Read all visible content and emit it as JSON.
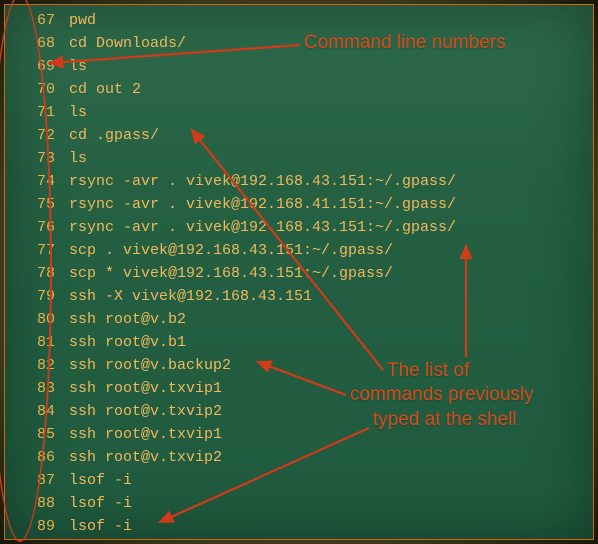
{
  "colors": {
    "text": "#f0b85a",
    "lineno": "#e6b24a",
    "annotation": "#d84a1a",
    "arrow": "#d23a1a",
    "terminal_bg": "#256043",
    "page_bg": "#5a5528"
  },
  "annotations": {
    "line_numbers": "Command line numbers",
    "list_line1": "The list of",
    "list_line2": "commands previously",
    "list_line3": "typed at the shell"
  },
  "history": [
    {
      "n": "67",
      "cmd": "pwd"
    },
    {
      "n": "68",
      "cmd": "cd Downloads/"
    },
    {
      "n": "69",
      "cmd": "ls"
    },
    {
      "n": "70",
      "cmd": "cd out 2"
    },
    {
      "n": "71",
      "cmd": "ls"
    },
    {
      "n": "72",
      "cmd": "cd .gpass/"
    },
    {
      "n": "73",
      "cmd": "ls"
    },
    {
      "n": "74",
      "cmd": "rsync -avr . vivek@192.168.43.151:~/.gpass/"
    },
    {
      "n": "75",
      "cmd": "rsync -avr . vivek@192.168.41.151:~/.gpass/"
    },
    {
      "n": "76",
      "cmd": "rsync -avr . vivek@192.168.43.151:~/.gpass/"
    },
    {
      "n": "77",
      "cmd": "scp . vivek@192.168.43.151:~/.gpass/"
    },
    {
      "n": "78",
      "cmd": "scp * vivek@192.168.43.151:~/.gpass/"
    },
    {
      "n": "79",
      "cmd": "ssh -X vivek@192.168.43.151"
    },
    {
      "n": "80",
      "cmd": "ssh root@v.b2"
    },
    {
      "n": "81",
      "cmd": "ssh root@v.b1"
    },
    {
      "n": "82",
      "cmd": "ssh root@v.backup2"
    },
    {
      "n": "83",
      "cmd": "ssh root@v.txvip1"
    },
    {
      "n": "84",
      "cmd": "ssh root@v.txvip2"
    },
    {
      "n": "85",
      "cmd": "ssh root@v.txvip1"
    },
    {
      "n": "86",
      "cmd": "ssh root@v.txvip2"
    },
    {
      "n": "87",
      "cmd": "lsof -i"
    },
    {
      "n": "88",
      "cmd": "lsof -i"
    },
    {
      "n": "89",
      "cmd": "lsof -i"
    }
  ]
}
